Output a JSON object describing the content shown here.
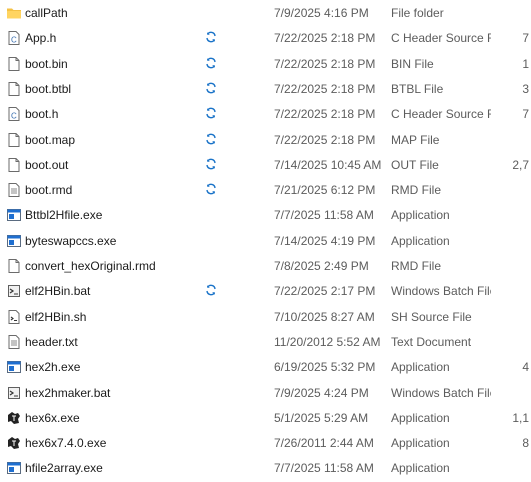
{
  "files": [
    {
      "name": "callPath",
      "date": "7/9/2025 4:16 PM",
      "type": "File folder",
      "size": "",
      "icon": "folder-icon",
      "sync": false
    },
    {
      "name": "App.h",
      "date": "7/22/2025 2:18 PM",
      "type": "C Header Source F...",
      "size": "7",
      "icon": "c-header-file-icon",
      "sync": true
    },
    {
      "name": "boot.bin",
      "date": "7/22/2025 2:18 PM",
      "type": "BIN File",
      "size": "1",
      "icon": "file-icon",
      "sync": true
    },
    {
      "name": "boot.btbl",
      "date": "7/22/2025 2:18 PM",
      "type": "BTBL File",
      "size": "3",
      "icon": "file-icon",
      "sync": true
    },
    {
      "name": "boot.h",
      "date": "7/22/2025 2:18 PM",
      "type": "C Header Source F...",
      "size": "7",
      "icon": "c-header-file-icon",
      "sync": true
    },
    {
      "name": "boot.map",
      "date": "7/22/2025 2:18 PM",
      "type": "MAP File",
      "size": "",
      "icon": "file-icon",
      "sync": true
    },
    {
      "name": "boot.out",
      "date": "7/14/2025 10:45 AM",
      "type": "OUT File",
      "size": "2,7",
      "icon": "file-icon",
      "sync": true
    },
    {
      "name": "boot.rmd",
      "date": "7/21/2025 6:12 PM",
      "type": "RMD File",
      "size": "",
      "icon": "text-file-icon",
      "sync": true
    },
    {
      "name": "Bttbl2Hfile.exe",
      "date": "7/7/2025 11:58 AM",
      "type": "Application",
      "size": "",
      "icon": "app-window-icon",
      "sync": false
    },
    {
      "name": "byteswapccs.exe",
      "date": "7/14/2025 4:19 PM",
      "type": "Application",
      "size": "",
      "icon": "app-window-icon",
      "sync": false
    },
    {
      "name": "convert_hexOriginal.rmd",
      "date": "7/8/2025 2:49 PM",
      "type": "RMD File",
      "size": "",
      "icon": "file-icon",
      "sync": false
    },
    {
      "name": "elf2HBin.bat",
      "date": "7/22/2025 2:17 PM",
      "type": "Windows Batch File",
      "size": "",
      "icon": "batch-file-icon",
      "sync": true
    },
    {
      "name": "elf2HBin.sh",
      "date": "7/10/2025 8:27 AM",
      "type": "SH Source File",
      "size": "",
      "icon": "script-file-icon",
      "sync": false
    },
    {
      "name": "header.txt",
      "date": "11/20/2012 5:52 AM",
      "type": "Text Document",
      "size": "",
      "icon": "text-file-icon",
      "sync": false
    },
    {
      "name": "hex2h.exe",
      "date": "6/19/2025 5:32 PM",
      "type": "Application",
      "size": "4",
      "icon": "app-window-icon",
      "sync": false
    },
    {
      "name": "hex2hmaker.bat",
      "date": "7/9/2025 4:24 PM",
      "type": "Windows Batch File",
      "size": "",
      "icon": "batch-file-icon",
      "sync": false
    },
    {
      "name": "hex6x.exe",
      "date": "5/1/2025 5:29 AM",
      "type": "Application",
      "size": "1,1",
      "icon": "ti-app-icon",
      "sync": false
    },
    {
      "name": "hex6x7.4.0.exe",
      "date": "7/26/2011 2:44 AM",
      "type": "Application",
      "size": "8",
      "icon": "ti-app-icon",
      "sync": false
    },
    {
      "name": "hfile2array.exe",
      "date": "7/7/2025 11:58 AM",
      "type": "Application",
      "size": "",
      "icon": "app-window-icon",
      "sync": false
    }
  ],
  "colors": {
    "folder": "#f4c144",
    "sync": "#1a73c8",
    "app": "#1f6fd0"
  }
}
